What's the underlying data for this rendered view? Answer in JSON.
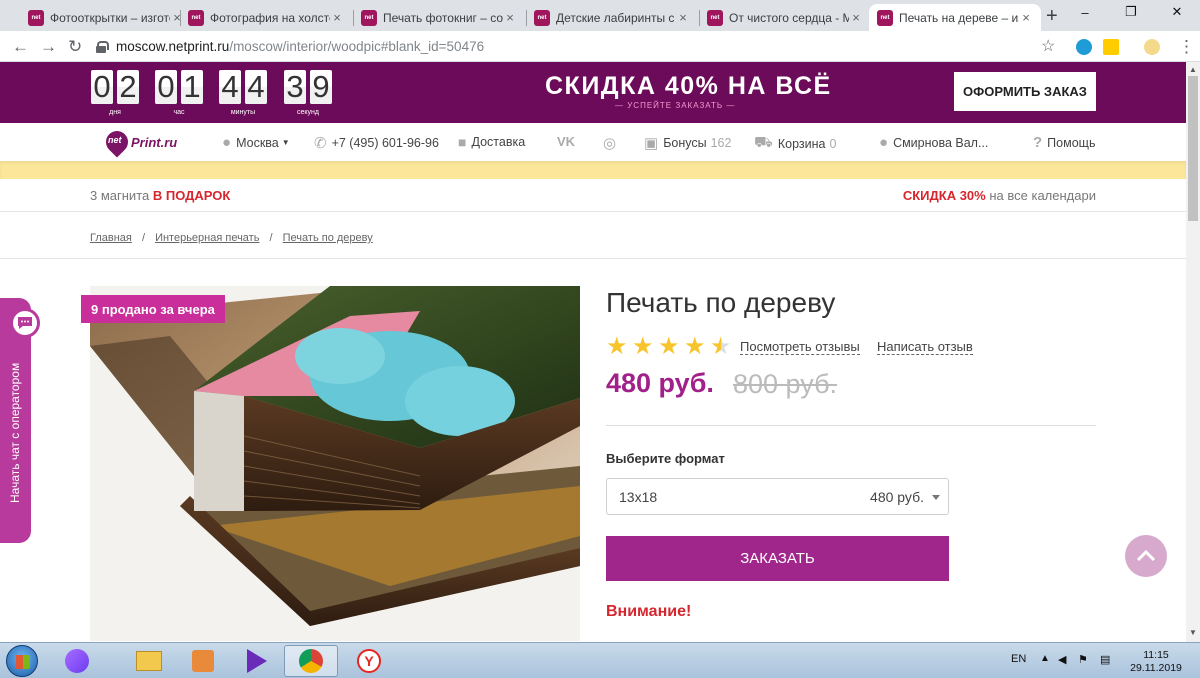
{
  "browser": {
    "tabs": [
      {
        "label": "Фотооткрытки – изготовление",
        "active": false
      },
      {
        "label": "Фотография на холсте",
        "active": false
      },
      {
        "label": "Печать фотокниг – создать",
        "active": false
      },
      {
        "label": "Детские лабиринты с фото",
        "active": false
      },
      {
        "label": "От чистого сердца - Mos",
        "active": false
      },
      {
        "label": "Печать на дереве – изго",
        "active": true
      }
    ],
    "tab_favicon_text": "net",
    "new_tab": "+",
    "close_glyph": "×",
    "url_host": "moscow.netprint.ru",
    "url_path": "/moscow/interior/woodpic#blank_id=50476",
    "window_controls": [
      "–",
      "❐",
      "✕"
    ]
  },
  "promo": {
    "countdown": [
      {
        "digits": [
          "0",
          "2"
        ],
        "label": "дня"
      },
      {
        "digits": [
          "0",
          "1"
        ],
        "label": "час"
      },
      {
        "digits": [
          "4",
          "4"
        ],
        "label": "минуты"
      },
      {
        "digits": [
          "3",
          "9"
        ],
        "label": "секунд"
      }
    ],
    "title": "СКИДКА 40% НА ВСЁ",
    "subtitle": "— УСПЕЙТЕ ЗАКАЗАТЬ —",
    "order_button": "ОФОРМИТЬ ЗАКАЗ",
    "background_color": "#6c0b59"
  },
  "site_nav": {
    "logo_net": "net",
    "logo_print": "Print.ru",
    "city": "Москва",
    "phone": "+7 (495) 601-96-96",
    "delivery": "Доставка",
    "vk": "VK",
    "bonuses": "Бонусы",
    "bonuses_count": "162",
    "cart": "Корзина",
    "cart_count": "0",
    "user": "Смирнова Вал...",
    "help": "Помощь"
  },
  "offers": {
    "left_prefix": "3 магнита",
    "left_highlight": "В ПОДАРОК",
    "right_highlight": "СКИДКА 30%",
    "right_suffix": "на все календари"
  },
  "breadcrumbs": [
    "Главная",
    "Интерьерная печать",
    "Печать по дереву"
  ],
  "breadcrumb_sep": "/",
  "product": {
    "badge": "9 продано за вчера",
    "title": "Печать по дереву",
    "rating": 4.5,
    "reviews_link": "Посмотреть отзывы",
    "write_review_link": "Написать отзыв",
    "price": "480 руб.",
    "old_price": "800 руб.",
    "format_label": "Выберите формат",
    "format_value": "13x18",
    "format_price": "480 руб.",
    "buy_button": "ЗАКАЗАТЬ",
    "warning": "Внимание!",
    "accent_color": "#a0268b"
  },
  "chat": {
    "label": "Начать чат с оператором"
  },
  "taskbar": {
    "lang": "EN",
    "time": "11:15",
    "date": "29.11.2019"
  }
}
